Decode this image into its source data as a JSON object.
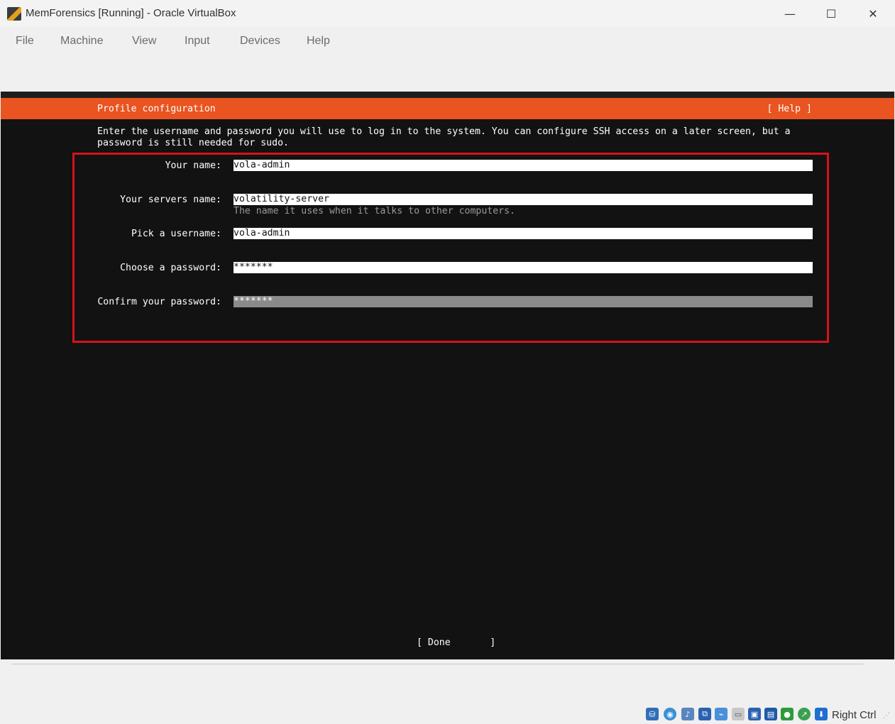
{
  "window": {
    "title": "MemForensics [Running] - Oracle VirtualBox",
    "minimize": "—",
    "maximize": "☐",
    "close": "✕"
  },
  "menu": {
    "items": [
      "File",
      "Machine",
      "View",
      "Input",
      "Devices",
      "Help"
    ]
  },
  "installer": {
    "header_title": "Profile configuration",
    "help_label": "[ Help ]",
    "intro_line1": "Enter the username and password you will use to log in to the system. You can configure SSH access on a later screen, but a",
    "intro_line2": "password is still needed for sudo.",
    "fields": [
      {
        "label": "Your name:",
        "value": "vola-admin"
      },
      {
        "label": "Your servers name:",
        "value": "volatility-server",
        "hint": "The name it uses when it talks to other computers."
      },
      {
        "label": "Pick a username:",
        "value": "vola-admin"
      },
      {
        "label": "Choose a password:",
        "value": "*******"
      },
      {
        "label": "Confirm your password:",
        "value": "*******"
      }
    ],
    "done_label": "[ Done       ]"
  },
  "status": {
    "host_key": "Right Ctrl",
    "icons": [
      "hard-disk-icon",
      "optical-drive-icon",
      "audio-icon",
      "network-icon",
      "usb-icon",
      "shared-folders-icon",
      "display-icon",
      "video-capture-icon",
      "recording-icon",
      "mouse-integration-icon",
      "keyboard-capture-icon"
    ],
    "colors": {
      "accent": "#e95420",
      "highlight_border": "#d6121a",
      "console_bg": "#121212"
    }
  }
}
